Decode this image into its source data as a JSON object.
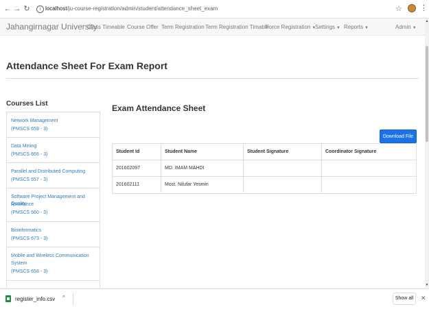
{
  "browser": {
    "url_host": "localhost",
    "url_path": "/ju-course-registration/admin/student/attendance_sheet_exam"
  },
  "navbar": {
    "brand": "Jahangirnagar University",
    "links": [
      "Class Timeable",
      "Course Offer",
      "Term Registration",
      "Term Registration Timable"
    ],
    "dropdowns": [
      "Force Registration",
      "Settings",
      "Reports"
    ],
    "user": "Admin"
  },
  "page": {
    "title": "Attendance Sheet For Exam Report",
    "courses_title": "Courses List",
    "sheet_title": "Exam Attendance Sheet",
    "download_label": "Download File"
  },
  "courses": [
    {
      "name": "Network Management",
      "code": "(PMSCS 659 - 3)"
    },
    {
      "name": "Data Mining",
      "code": "(PMSCS 666 - 3)"
    },
    {
      "name": "Parallel and Distributed Computing",
      "code": "(PMSCS 657 - 3)"
    },
    {
      "name": "Software Project Management and Quality",
      "name2": "Assurance",
      "code": "(PMSCS 660 - 3)"
    },
    {
      "name": "Bioinformatics",
      "code": "(PMSCS 673 - 3)"
    },
    {
      "name": "Mobile and Wireless Communication",
      "name2": "System",
      "code": "(PMSCS 658 - 3)"
    }
  ],
  "table": {
    "headers": [
      "Student Id",
      "Student Name",
      "Student Signature",
      "Coordinator Signature"
    ],
    "rows": [
      [
        "201602097",
        "MD. IMAM MAHDI",
        "",
        ""
      ],
      [
        "201602111",
        "Most. Nilufar Yesmin",
        "",
        ""
      ]
    ]
  },
  "downloads": {
    "file": "register_info.csv",
    "show_all": "Show all"
  }
}
